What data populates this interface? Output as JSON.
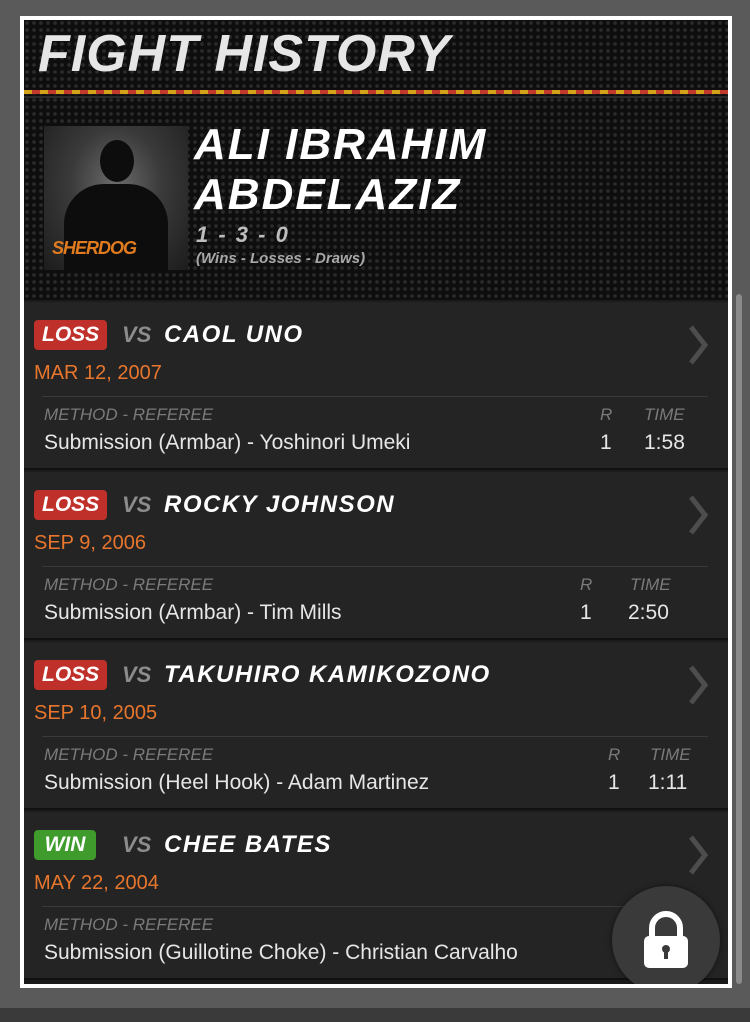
{
  "header": {
    "title": "FIGHT HISTORY",
    "logo_text": "SHERDOG"
  },
  "fighter": {
    "name": "ALI IBRAHIM ABDELAZIZ",
    "record": "1 - 3 - 0",
    "record_legend": "(Wins - Losses - Draws)"
  },
  "labels": {
    "vs": "VS",
    "method_referee": "METHOD - REFEREE",
    "round": "R",
    "time": "TIME"
  },
  "fights": [
    {
      "result": "LOSS",
      "opponent": "CAOL UNO",
      "date": "MAR 12, 2007",
      "method": "Submission (Armbar) - Yoshinori Umeki",
      "round": "1",
      "time": "1:58"
    },
    {
      "result": "LOSS",
      "opponent": "ROCKY JOHNSON",
      "date": "SEP 9, 2006",
      "method": "Submission (Armbar) - Tim Mills",
      "round": "1",
      "time": "2:50"
    },
    {
      "result": "LOSS",
      "opponent": "TAKUHIRO KAMIKOZONO",
      "date": "SEP 10, 2005",
      "method": "Submission (Heel Hook) - Adam Martinez",
      "round": "1",
      "time": "1:11"
    },
    {
      "result": "WIN",
      "opponent": "CHEE BATES",
      "date": "MAY 22, 2004",
      "method": "Submission (Guillotine Choke) - Christian Carvalho",
      "round": "",
      "time": ""
    }
  ],
  "colors": {
    "loss": "#c0302a",
    "win": "#3e9b2c",
    "date": "#e8762d",
    "panel": "#242424"
  },
  "icons": [
    "chevron-right-icon",
    "lock-icon"
  ]
}
